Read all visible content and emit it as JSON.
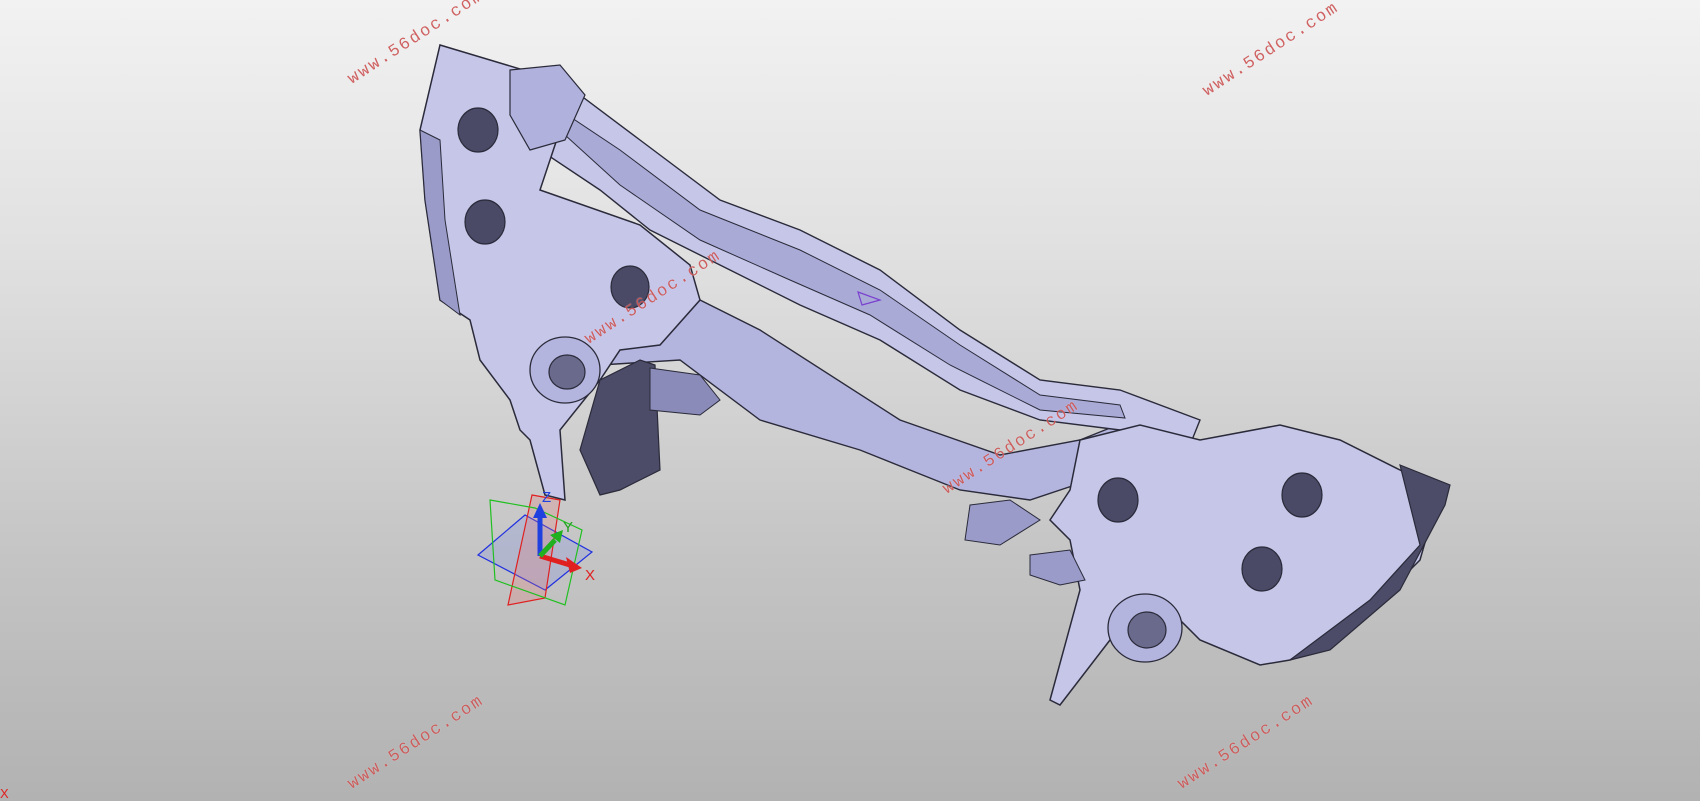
{
  "watermarks": [
    "www.56doc.com",
    "www.56doc.com",
    "www.56doc.com",
    "www.56doc.com",
    "www.56doc.com",
    "www.56doc.com"
  ],
  "triad": {
    "x_label": "X",
    "y_label": "Y",
    "z_label": "Z"
  },
  "corner_marker": "X",
  "colors": {
    "part_face": "#c5c6e8",
    "part_shadow": "#9a9bc8",
    "part_dark": "#505070",
    "edge": "#2a2a3a",
    "axis_x": "#e02020",
    "axis_y": "#20b020",
    "axis_z": "#2040e0"
  }
}
